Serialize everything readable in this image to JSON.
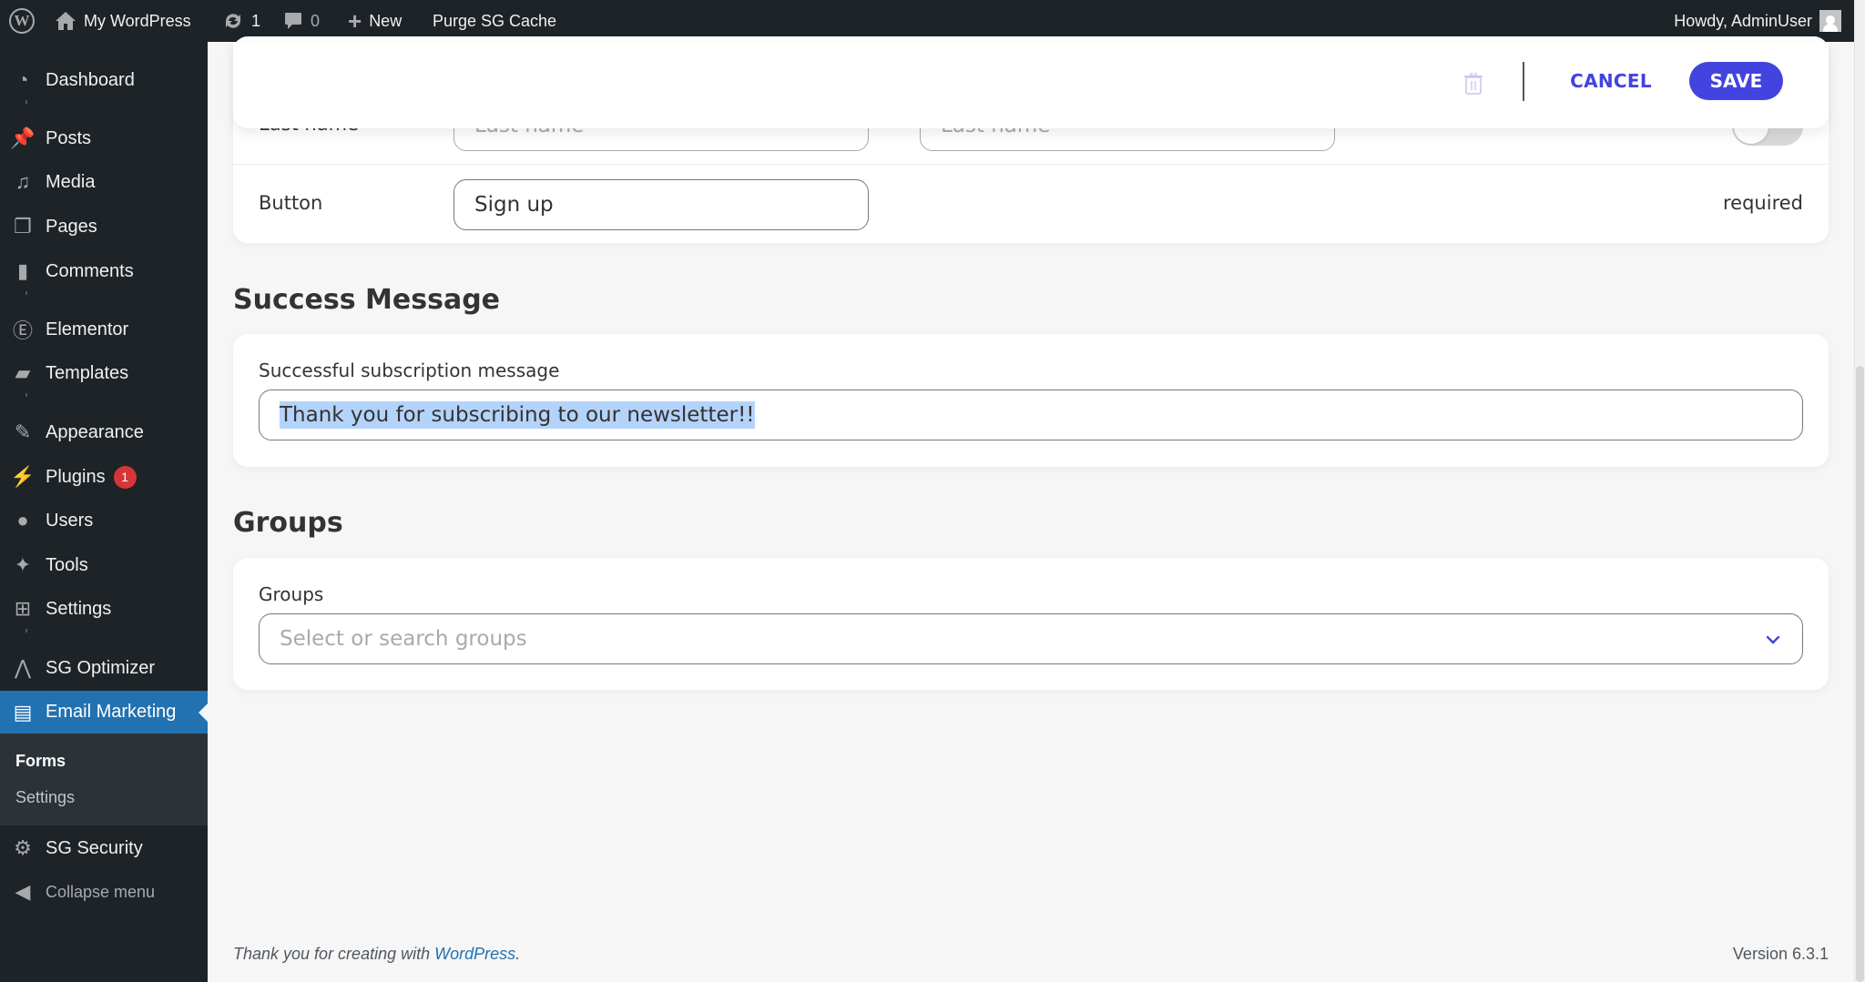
{
  "adminbar": {
    "site_name": "My WordPress",
    "updates_count": "1",
    "comments_count": "0",
    "new_label": "New",
    "purge_label": "Purge SG Cache",
    "howdy": "Howdy, AdminUser"
  },
  "sidebar": {
    "items": [
      {
        "label": "Dashboard",
        "icon": "dashboard-icon"
      },
      {
        "label": "Posts",
        "icon": "pushpin-icon"
      },
      {
        "label": "Media",
        "icon": "media-icon"
      },
      {
        "label": "Pages",
        "icon": "pages-icon"
      },
      {
        "label": "Comments",
        "icon": "comment-icon"
      },
      {
        "label": "Elementor",
        "icon": "elementor-icon"
      },
      {
        "label": "Templates",
        "icon": "folder-icon"
      },
      {
        "label": "Appearance",
        "icon": "paintbrush-icon"
      },
      {
        "label": "Plugins",
        "icon": "plugin-icon",
        "badge": "1"
      },
      {
        "label": "Users",
        "icon": "user-icon"
      },
      {
        "label": "Tools",
        "icon": "wrench-icon"
      },
      {
        "label": "Settings",
        "icon": "settings-icon"
      },
      {
        "label": "SG Optimizer",
        "icon": "sg-optimizer-icon"
      },
      {
        "label": "Email Marketing",
        "icon": "email-marketing-icon",
        "current": true
      },
      {
        "label": "SG Security",
        "icon": "lock-gear-icon"
      }
    ],
    "submenu": [
      {
        "label": "Forms",
        "current": true
      },
      {
        "label": "Settings"
      }
    ],
    "collapse_label": "Collapse menu"
  },
  "header": {
    "cancel_label": "CANCEL",
    "save_label": "SAVE"
  },
  "fields": {
    "last_name": {
      "label": "Last name",
      "placeholder_1": "Last name",
      "placeholder_2": "Last name",
      "enabled": false
    },
    "button": {
      "label": "Button",
      "value": "Sign up",
      "status": "required"
    }
  },
  "success": {
    "title": "Success Message",
    "field_label": "Successful subscription message",
    "value": "Thank you for subscribing to our newsletter!!"
  },
  "groups": {
    "title": "Groups",
    "field_label": "Groups",
    "placeholder": "Select or search groups"
  },
  "footer": {
    "thanks_prefix": "Thank you for creating with ",
    "link_text": "WordPress",
    "suffix": ".",
    "version": "Version 6.3.1"
  },
  "colors": {
    "accent": "#4343e0",
    "wp_blue": "#2271b1",
    "adminbar_bg": "#1d2327",
    "badge_red": "#d63638",
    "selection": "#b4d3fb"
  }
}
